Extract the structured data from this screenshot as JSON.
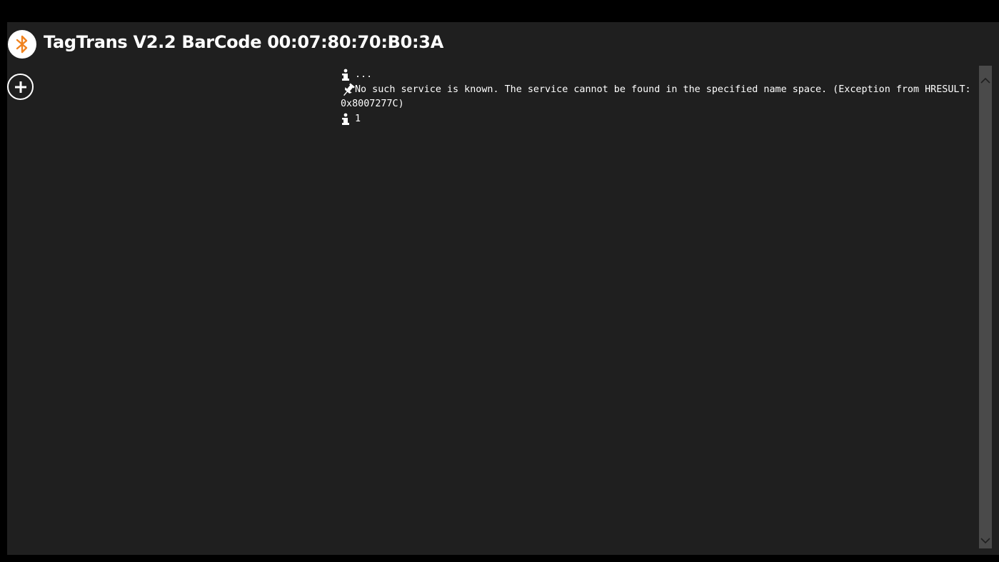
{
  "window": {
    "title": "TagTrans V2.2 BarCode 00:07:80:70:B0:3A"
  },
  "icons": {
    "app": "bluetooth-icon",
    "add": "plus-circle-icon",
    "info": "info-icon",
    "error": "pin-icon"
  },
  "colors": {
    "background": "#1f1f1f",
    "bluetooth_accent": "#f0821e",
    "text": "#ffffff",
    "scrollbar": "#4a4a4a"
  },
  "log": [
    {
      "type": "info",
      "icon": "info-icon",
      "message": "..."
    },
    {
      "type": "error",
      "icon": "pin-icon",
      "message": "No such service is known. The service cannot be found in the specified name space. (Exception from HRESULT: 0x8007277C)"
    },
    {
      "type": "info",
      "icon": "info-icon",
      "message": "1"
    }
  ]
}
